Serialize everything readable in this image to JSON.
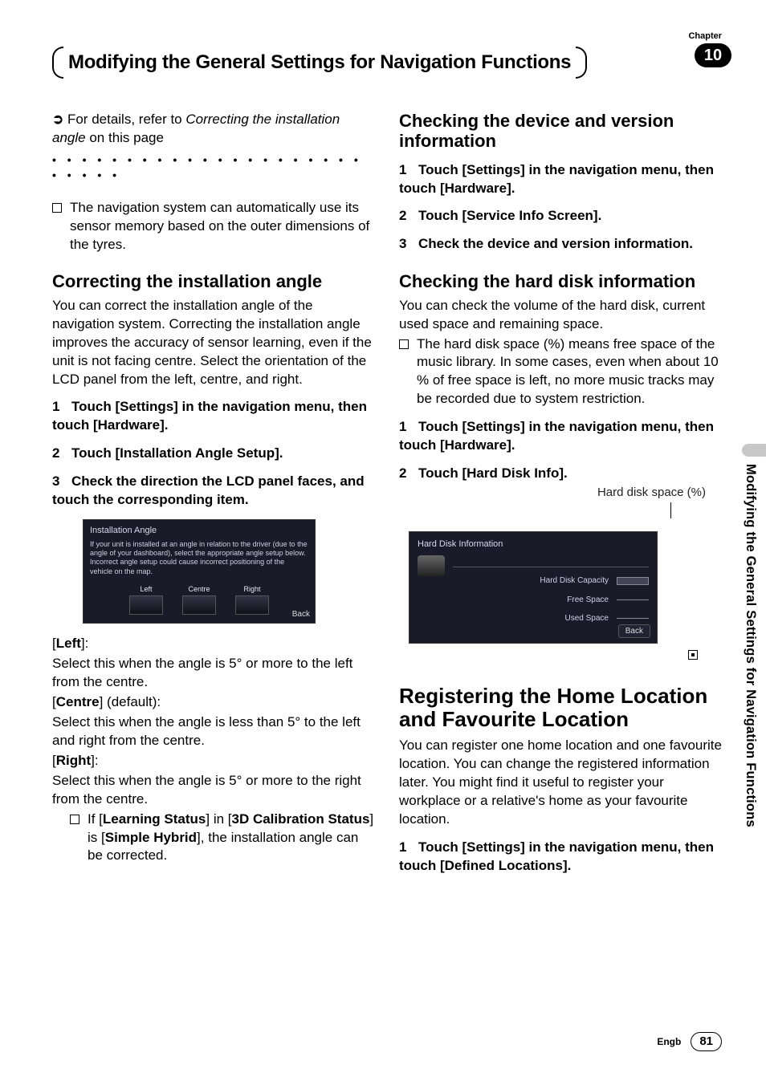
{
  "chapter": {
    "label": "Chapter",
    "number": "10"
  },
  "page_title": "Modifying the General Settings for Navigation Functions",
  "side_tab": "Modifying the General Settings for Navigation Functions",
  "left": {
    "xref_prefix": "For details, refer to ",
    "xref_italic": "Correcting the installation angle",
    "xref_suffix": " on this page",
    "auto_sensor": "The navigation system can automatically use its sensor memory based on the outer dimensions of the tyres.",
    "h_correcting": "Correcting the installation angle",
    "correcting_body": "You can correct the installation angle of the navigation system. Correcting the installation angle improves the accuracy of sensor learning, even if the unit is not facing centre. Select the orientation of the LCD panel from the left, centre, and right.",
    "step1": "Touch [Settings] in the navigation menu, then touch [Hardware].",
    "step2": "Touch [Installation Angle Setup].",
    "step3": "Check the direction the LCD panel faces, and touch the corresponding item.",
    "ss": {
      "title": "Installation Angle",
      "body": "If your unit is installed at an angle in relation to the driver (due to the angle of your dashboard), select the appropriate angle setup below. Incorrect angle setup could cause incorrect positioning of the vehicle on the map.",
      "opt_left": "Left",
      "opt_centre": "Centre",
      "opt_right": "Right",
      "back": "Back"
    },
    "opt_left_label": "Left",
    "opt_left_body": "Select this when the angle is 5° or more to the left from the centre.",
    "opt_centre_label": "Centre",
    "opt_centre_default": " (default):",
    "opt_centre_body": "Select this when the angle is less than 5° to the left and right from the centre.",
    "opt_right_label": "Right",
    "opt_right_body": "Select this when the angle is 5° or more to the right from the centre.",
    "note_if": "If [",
    "note_ls": "Learning Status",
    "note_in": "] in [",
    "note_3d": "3D Calibration Status",
    "note_is": "] is [",
    "note_sh": "Simple Hybrid",
    "note_end": "], the installation angle can be corrected."
  },
  "right": {
    "h_device": "Checking the device and version information",
    "d_step1": "Touch [Settings] in the navigation menu, then touch [Hardware].",
    "d_step2": "Touch [Service Info Screen].",
    "d_step3": "Check the device and version information.",
    "h_hdd": "Checking the hard disk information",
    "hdd_body": "You can check the volume of the hard disk, current used space and remaining space.",
    "hdd_note": "The hard disk space (%) means free space of the music library. In some cases, even when about 10 % of free space is left, no more music tracks may be recorded due to system restriction.",
    "hdd_step1": "Touch [Settings] in the navigation menu, then touch [Hardware].",
    "hdd_step2": "Touch [Hard Disk Info].",
    "callout": "Hard disk space (%)",
    "ss2": {
      "title": "Hard Disk Information",
      "cap": "Hard Disk Capacity",
      "free": "Free Space",
      "used": "Used Space",
      "back": "Back"
    },
    "h_register": "Registering the Home Location and Favourite Location",
    "reg_body": "You can register one home location and one favourite location. You can change the registered information later. You might find it useful to register your workplace or a relative's home as your favourite location.",
    "reg_step1": "Touch [Settings] in the navigation menu, then touch [Defined Locations]."
  },
  "footer": {
    "lang": "Engb",
    "page": "81"
  }
}
